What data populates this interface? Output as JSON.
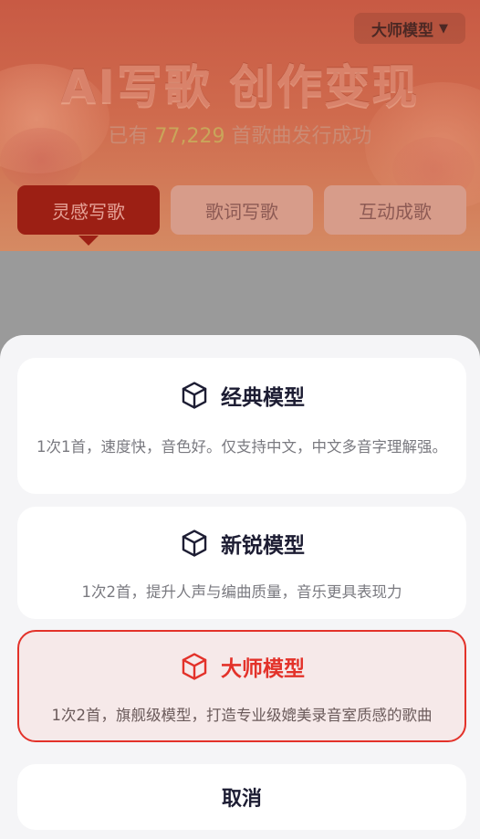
{
  "header": {
    "model_switch_label": "大师模型",
    "title": "AI写歌 创作变现",
    "subtitle_prefix": "已有",
    "subtitle_count": "77,229",
    "subtitle_suffix": "首歌曲发行成功",
    "tabs": [
      {
        "label": "灵感写歌",
        "active": true
      },
      {
        "label": "歌词写歌",
        "active": false
      },
      {
        "label": "互动成歌",
        "active": false
      }
    ]
  },
  "model_sheet": {
    "options": [
      {
        "name": "经典模型",
        "description": "1次1首，速度快，音色好。仅支持中文，中文多音字理解强。",
        "selected": false
      },
      {
        "name": "新锐模型",
        "description": "1次2首，提升人声与编曲质量，音乐更具表现力",
        "selected": false
      },
      {
        "name": "大师模型",
        "description": "1次2首，旗舰级模型，打造专业级媲美录音室质感的歌曲",
        "selected": true
      }
    ],
    "cancel_label": "取消"
  },
  "colors": {
    "accent": "#e3322a",
    "active_tab": "#9c1f14",
    "highlight_number": "#c9a55a",
    "text_dark": "#1d1d33"
  },
  "icons": {
    "model_icon": "cube-icon",
    "dropdown_icon": "triangle-down-icon"
  }
}
